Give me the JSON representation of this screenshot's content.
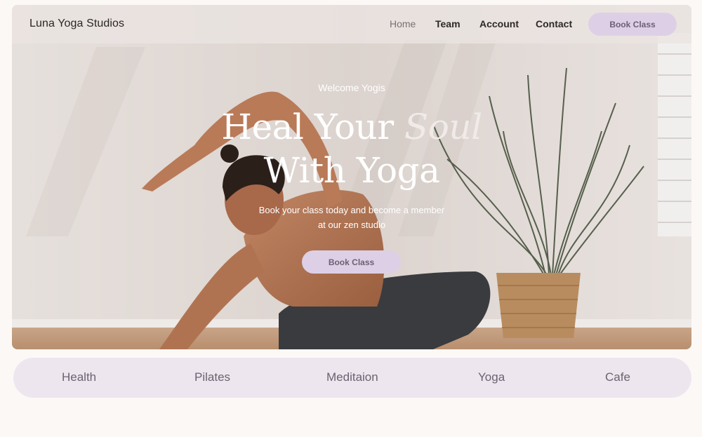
{
  "nav": {
    "brand": "Luna Yoga Studios",
    "links": [
      {
        "label": "Home",
        "active": true
      },
      {
        "label": "Team",
        "active": false
      },
      {
        "label": "Account",
        "active": false
      },
      {
        "label": "Contact",
        "active": false
      }
    ],
    "cta": "Book Class"
  },
  "hero": {
    "eyebrow": "Welcome Yogis",
    "headline_part1": "Heal Your ",
    "headline_italic": "Soul",
    "headline_line2": "With Yoga",
    "subtext_line1": "Book your class today and become a member",
    "subtext_line2": "at our zen studio",
    "cta": "Book Class",
    "image_icon": "yoga-photo"
  },
  "categories": [
    "Health",
    "Pilates",
    "Meditaion",
    "Yoga",
    "Cafe"
  ],
  "colors": {
    "accent": "#ddd0e6",
    "accent_text": "#6d5f73",
    "page_bg": "#fcf8f6",
    "category_bar": "#ede6ef"
  }
}
